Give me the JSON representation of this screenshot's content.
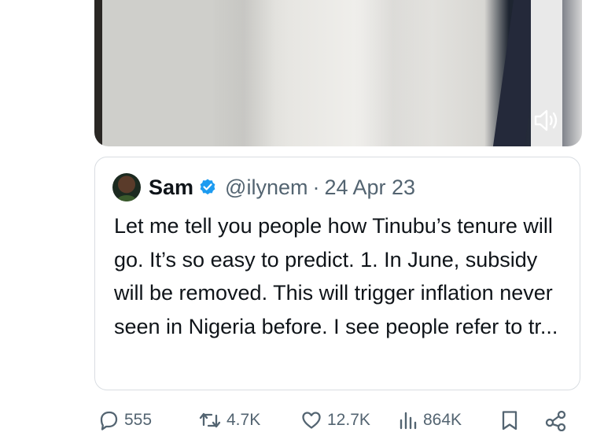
{
  "media": {
    "volume_icon": "speaker-sound-icon"
  },
  "quote": {
    "name": "Sam",
    "handle": "@ilynem",
    "separator": "·",
    "date": "24 Apr 23",
    "text": "Let me tell you people how Tinubu’s tenure will go. It’s so easy to predict. 1. In June, subsidy will be removed. This will trigger inflation never seen in Nigeria before. I see people refer to tr..."
  },
  "actions": {
    "replies": "555",
    "reposts": "4.7K",
    "likes": "12.7K",
    "views": "864K"
  },
  "colors": {
    "text": "#0f1419",
    "muted": "#536471",
    "verified": "#1d9bf0",
    "border": "#d9dde2"
  }
}
